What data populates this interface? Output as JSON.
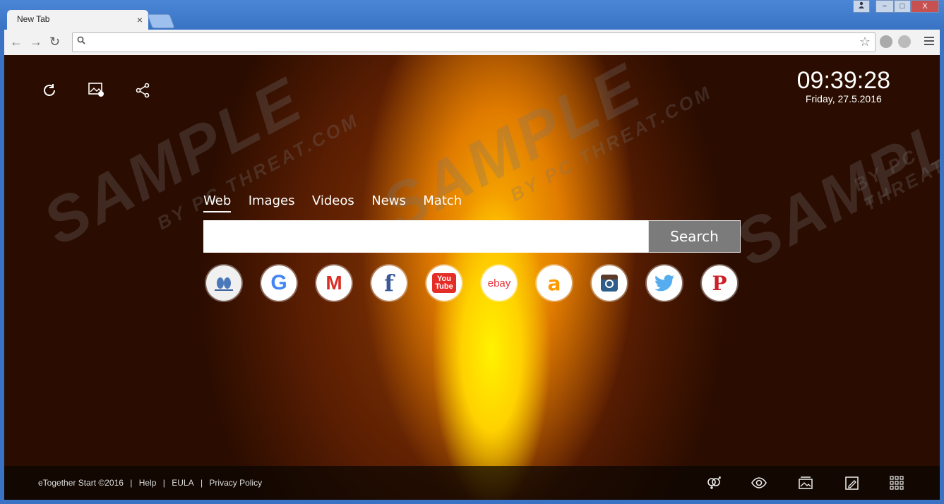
{
  "browser": {
    "tab_title": "New Tab",
    "tab_close": "×",
    "url": "",
    "window_controls": [
      "−",
      "□",
      "X"
    ]
  },
  "page": {
    "clock_time": "09:39:28",
    "clock_date": "Friday, 27.5.2016",
    "search_tabs": [
      "Web",
      "Images",
      "Videos",
      "News",
      "Match"
    ],
    "search_active": "Web",
    "search_button": "Search",
    "search_placeholder": "",
    "shortcuts": [
      {
        "name": "eTogether",
        "icon": "two-birds-icon"
      },
      {
        "name": "Google",
        "icon": "google-icon",
        "label": "G"
      },
      {
        "name": "Gmail",
        "icon": "gmail-icon",
        "label": "M"
      },
      {
        "name": "Facebook",
        "icon": "facebook-icon",
        "label": "f"
      },
      {
        "name": "YouTube",
        "icon": "youtube-icon",
        "label": "You Tube"
      },
      {
        "name": "eBay",
        "icon": "ebay-icon",
        "label": "ebay"
      },
      {
        "name": "Amazon",
        "icon": "amazon-icon",
        "label": "a"
      },
      {
        "name": "Instagram",
        "icon": "instagram-icon"
      },
      {
        "name": "Twitter",
        "icon": "twitter-icon"
      },
      {
        "name": "Pinterest",
        "icon": "pinterest-icon",
        "label": "P"
      }
    ],
    "watermark_main": "SAMPLE",
    "watermark_sub": "BY PC THREAT.COM"
  },
  "footer": {
    "copyright": "eTogether Start ©2016",
    "sep": "|",
    "links": [
      "Help",
      "EULA",
      "Privacy Policy"
    ]
  },
  "colors": {
    "chrome_blue": "#3a73c4",
    "search_button": "#7b7b7b"
  }
}
